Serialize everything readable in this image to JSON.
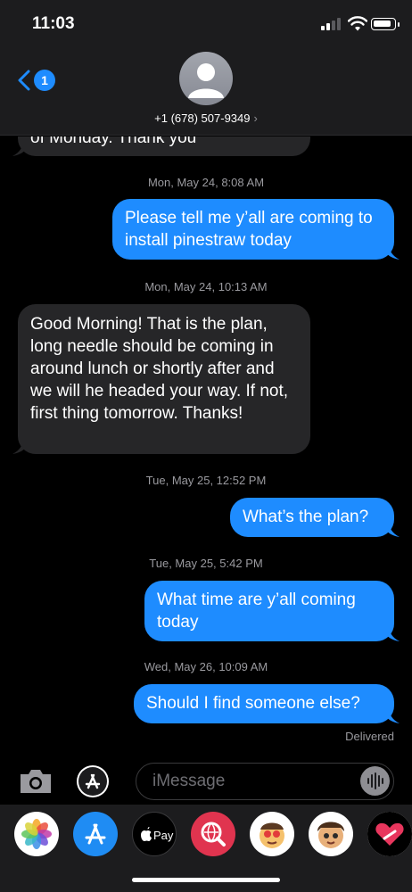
{
  "status": {
    "time": "11:03",
    "battery_level": 0.8
  },
  "header": {
    "back_count": "1",
    "contact": "+1 (678) 507-9349",
    "chevron": "›"
  },
  "messages": [
    {
      "type": "in",
      "text": "of Monday. Thank you"
    },
    {
      "type": "timestamp",
      "text": "Mon, May 24, 8:08 AM"
    },
    {
      "type": "out",
      "text": "Please tell me y’all are coming to install pinestraw today"
    },
    {
      "type": "timestamp",
      "text": "Mon, May 24, 10:13 AM"
    },
    {
      "type": "in",
      "text": "Good Morning! That is the plan, long needle should be coming in around lunch or shortly after and we will he headed your way. If not, first thing tomorrow. Thanks!"
    },
    {
      "type": "timestamp",
      "text": "Tue, May 25, 12:52 PM"
    },
    {
      "type": "out",
      "text": "What’s the plan?"
    },
    {
      "type": "timestamp",
      "text": "Tue, May 25, 5:42 PM"
    },
    {
      "type": "out",
      "text": "What time are y’all coming today"
    },
    {
      "type": "timestamp",
      "text": "Wed, May 26, 10:09 AM"
    },
    {
      "type": "out",
      "text": "Should I find someone else?"
    },
    {
      "type": "status",
      "text": "Delivered"
    }
  ],
  "composer": {
    "placeholder": "iMessage"
  },
  "app_drawer": {
    "apps": [
      {
        "name": "photos-app",
        "icon": "photos-icon"
      },
      {
        "name": "app-store-app",
        "icon": "app-store-icon"
      },
      {
        "name": "apple-pay-app",
        "icon": "apple-pay-icon",
        "label": "Pay"
      },
      {
        "name": "images-search-app",
        "icon": "globe-search-icon"
      },
      {
        "name": "memoji-stickers-app",
        "icon": "memoji-icon"
      },
      {
        "name": "animoji-app",
        "icon": "animoji-icon"
      },
      {
        "name": "digital-touch-app",
        "icon": "heart-icon"
      }
    ]
  },
  "colors": {
    "outgoing": "#1e8cff",
    "incoming": "#262628",
    "background": "#000000",
    "bar": "#1c1c1e"
  }
}
